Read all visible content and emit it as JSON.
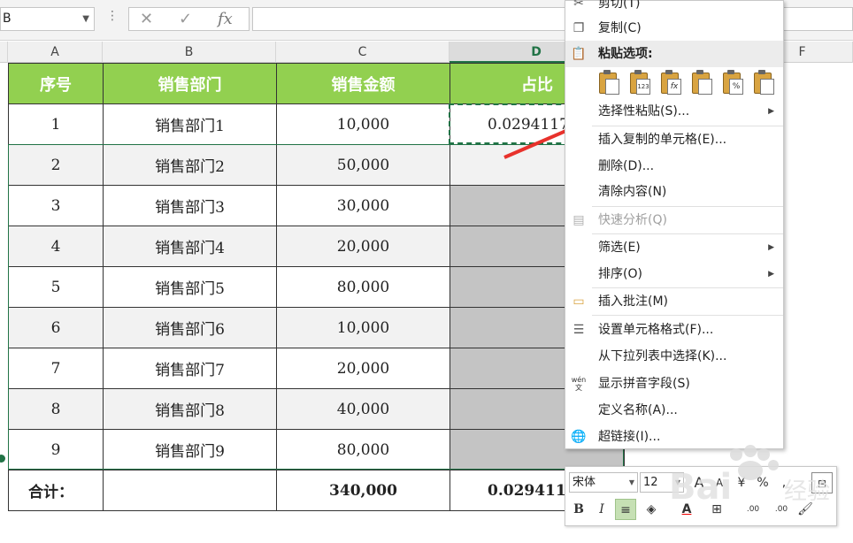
{
  "name_box": {
    "value": "B"
  },
  "formula_bar": {
    "cancel_icon": "✕",
    "enter_icon": "✓",
    "fx_icon": "fx",
    "value": ""
  },
  "columns": [
    "A",
    "B",
    "C",
    "D",
    "F"
  ],
  "table": {
    "headers": [
      "序号",
      "销售部门",
      "销售金额",
      "占比"
    ],
    "rows": [
      [
        "1",
        "销售部门1",
        "10,000",
        "0.0294117"
      ],
      [
        "2",
        "销售部门2",
        "50,000",
        ""
      ],
      [
        "3",
        "销售部门3",
        "30,000",
        ""
      ],
      [
        "4",
        "销售部门4",
        "20,000",
        ""
      ],
      [
        "5",
        "销售部门5",
        "80,000",
        ""
      ],
      [
        "6",
        "销售部门6",
        "10,000",
        ""
      ],
      [
        "7",
        "销售部门7",
        "20,000",
        ""
      ],
      [
        "8",
        "销售部门8",
        "40,000",
        ""
      ],
      [
        "9",
        "销售部门9",
        "80,000",
        ""
      ]
    ],
    "total": [
      "合计：",
      "",
      "340,000",
      "0.0294117"
    ]
  },
  "context_menu": {
    "cut": "剪切(T)",
    "copy": "复制(C)",
    "paste_options": "粘贴选项:",
    "paste_icon_labels": [
      "",
      "123",
      "fx",
      "",
      "%",
      ""
    ],
    "paste_special": "选择性粘贴(S)...",
    "insert_copied": "插入复制的单元格(E)...",
    "delete": "删除(D)...",
    "clear": "清除内容(N)",
    "quick_analysis": "快速分析(Q)",
    "filter": "筛选(E)",
    "sort": "排序(O)",
    "insert_comment": "插入批注(M)",
    "format_cells": "设置单元格格式(F)...",
    "pick_from_list": "从下拉列表中选择(K)...",
    "pinyin": "显示拼音字段(S)",
    "define_name": "定义名称(A)...",
    "hyperlink": "超链接(I)...",
    "pinyin_icon_text": "wén"
  },
  "mini_toolbar": {
    "font": "宋体",
    "size": "12",
    "grow": "A",
    "shrink": "A",
    "percent": "%",
    "comma": ",",
    "bold": "B",
    "italic": "I",
    "align": "≡",
    "font_color": "A",
    "inc_decimal": ".00",
    "dec_decimal": ".00"
  },
  "colors": {
    "header_green": "#92d050",
    "excel_green": "#217346",
    "arrow_red": "#e8322c"
  }
}
